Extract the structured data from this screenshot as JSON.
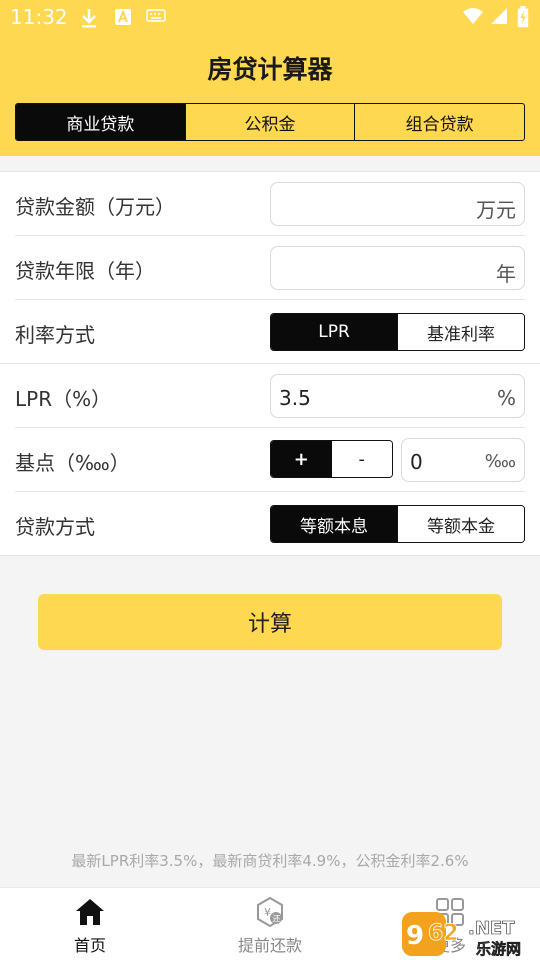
{
  "status": {
    "time": "11:32"
  },
  "app": {
    "title": "房贷计算器"
  },
  "tabs": [
    {
      "label": "商业贷款",
      "active": true
    },
    {
      "label": "公积金",
      "active": false
    },
    {
      "label": "组合贷款",
      "active": false
    }
  ],
  "form": {
    "amount": {
      "label": "贷款金额（万元）",
      "value": "",
      "unit": "万元"
    },
    "years": {
      "label": "贷款年限（年）",
      "value": "",
      "unit": "年"
    },
    "rate_mode": {
      "label": "利率方式",
      "options": [
        "LPR",
        "基准利率"
      ],
      "selected": "LPR"
    },
    "lpr": {
      "label": "LPR（%）",
      "value": "3.5",
      "unit": "%"
    },
    "basis": {
      "label": "基点（‱）",
      "plus": "+",
      "minus": "-",
      "sign_selected": "+",
      "value": "0",
      "unit": "‱"
    },
    "repay": {
      "label": "贷款方式",
      "options": [
        "等额本息",
        "等额本金"
      ],
      "selected": "等额本息"
    }
  },
  "calc_button": "计算",
  "rate_note": "最新LPR利率3.5%，最新商贷利率4.9%，公积金利率2.6%",
  "bottom_nav": [
    {
      "label": "首页",
      "icon": "home-icon",
      "active": true
    },
    {
      "label": "提前还款",
      "icon": "prepay-icon",
      "active": false
    },
    {
      "label": "更多",
      "icon": "more-icon",
      "active": false
    }
  ],
  "watermark": {
    "text": "962.NET",
    "subtext": "乐游网"
  },
  "colors": {
    "accent": "#fdd850",
    "selected": "#0a0a0a",
    "background": "#f4f4f4"
  }
}
